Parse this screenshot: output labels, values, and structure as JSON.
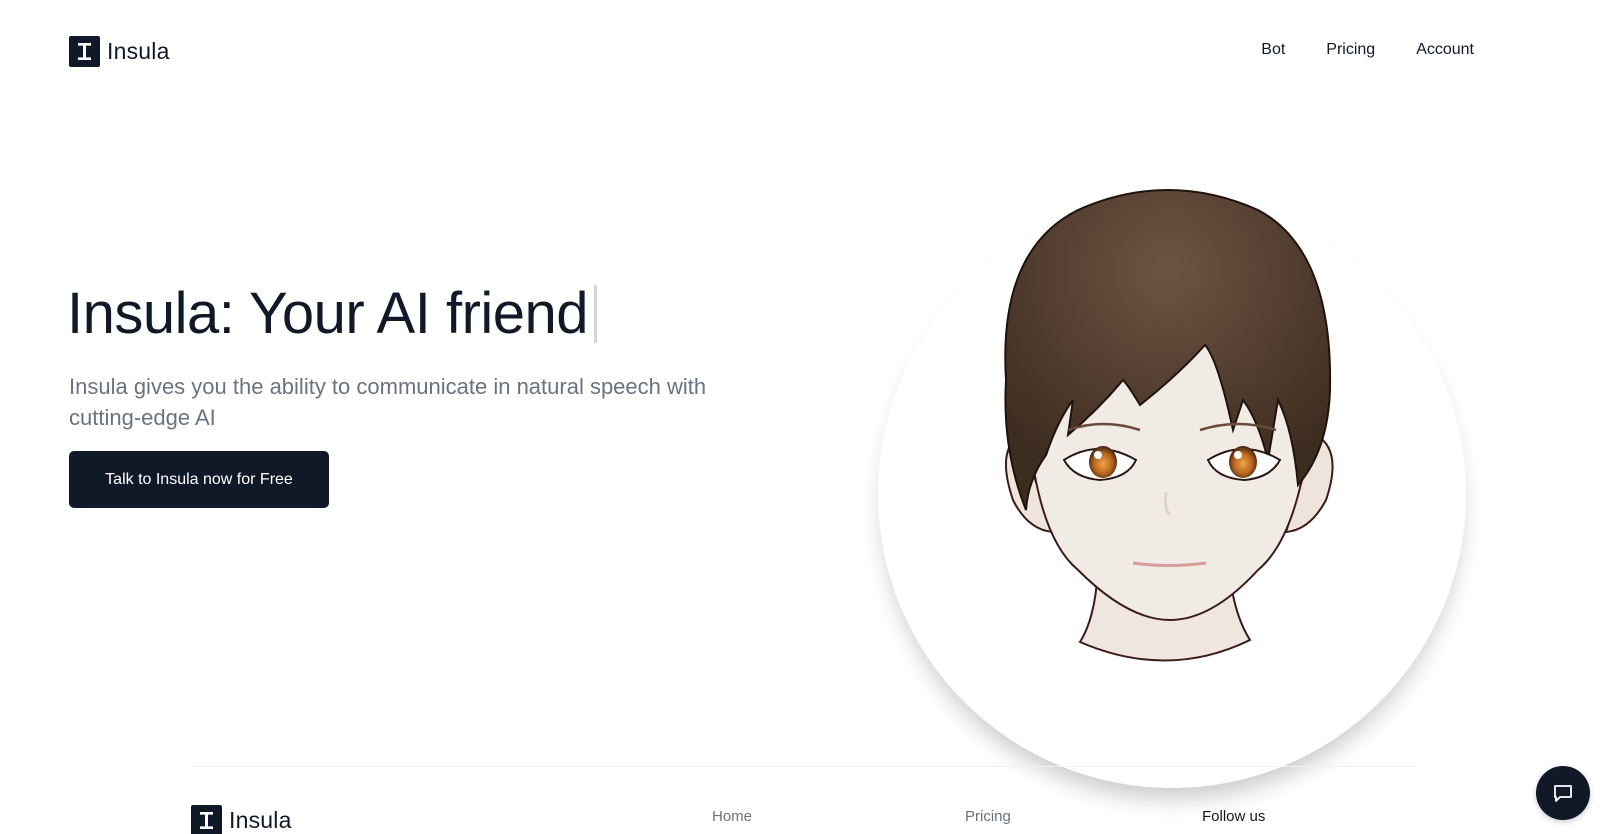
{
  "brand": {
    "name": "Insula"
  },
  "nav": {
    "items": [
      "Bot",
      "Pricing",
      "Account"
    ]
  },
  "hero": {
    "title": "Insula: Your AI friend",
    "subtitle": "Insula gives you the ability to communicate in natural speech with cutting-edge AI",
    "cta_label": "Talk to Insula now for Free"
  },
  "footer": {
    "brand": "Insula",
    "links": [
      "Home",
      "Pricing"
    ],
    "follow_label": "Follow us"
  },
  "icons": {
    "logo": "letter-i-logo-icon",
    "chat": "chat-bubble-icon"
  },
  "colors": {
    "primary": "#111827",
    "muted_text": "#6b7280"
  }
}
